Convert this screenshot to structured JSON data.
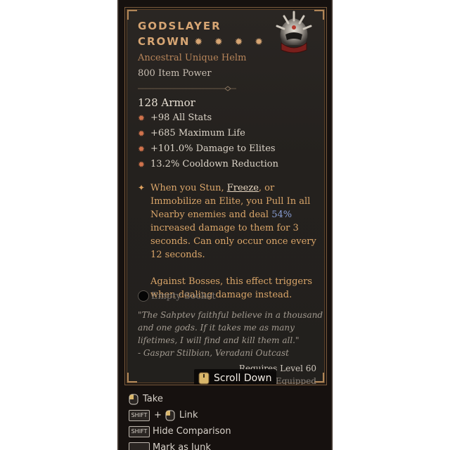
{
  "item": {
    "name_line1": "GODSLAYER",
    "name_line2": "CROWN",
    "stars": "✹ ✹ ✹ ✹",
    "type": "Ancestral Unique Helm",
    "power": "800 Item Power",
    "armor": "128 Armor",
    "affixes": [
      "+98 All Stats",
      "+685 Maximum Life",
      "+101.0% Damage to Elites",
      "13.2% Cooldown Reduction"
    ],
    "unique_power": {
      "part_a": "When you Stun, ",
      "freeze": "Freeze",
      "part_b": ", or Immobilize an Elite, you Pull In all Nearby enemies and deal ",
      "value": "54%",
      "part_c": " increased damage to them for 3 seconds. Can only occur once every 12 seconds.",
      "paragraph2": "Against Bosses, this effect triggers when dealing damage instead."
    },
    "socket": "Empty Socket",
    "flavor": "\"The Sahptev faithful believe in a thousand and one gods. If it takes me as many lifetimes, I will find and kill them all.\"",
    "author": "- Gaspar Stilbian, Veradani Outcast",
    "requires": "Requires Level 60",
    "equipped": "Unique Equipped"
  },
  "overlay": {
    "scroll_label": "Scroll Down"
  },
  "actions": {
    "take": "Take",
    "shift_key": "SHIFT",
    "plus": "+",
    "link": "Link",
    "hide_comparison": "Hide Comparison",
    "mark_junk": "Mark as Junk"
  },
  "colors": {
    "title": "#d6a573",
    "unique_text": "#dba66a",
    "highlight_value": "#8a9fd6",
    "affix_bullet": "#d1734c"
  }
}
